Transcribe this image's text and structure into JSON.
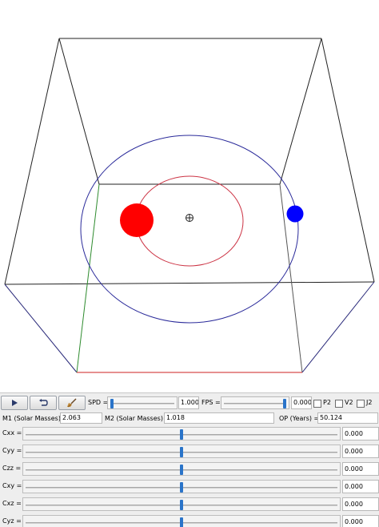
{
  "toolbar": {
    "spd_label": "SPD =",
    "spd_value": "1.000",
    "spd_level": 0.01,
    "fps_label": "FPS =",
    "fps_value": "0.000",
    "fps_level": 0.99,
    "check_p2": "P2",
    "check_v2": "V2",
    "check_j2": "J2",
    "buttons": [
      "play-icon",
      "reset-icon",
      "broom-icon"
    ]
  },
  "masses": {
    "m1_label": "M1 (Solar Masses) =",
    "m1_value": "2.063",
    "m2_label": "M2 (Solar Masses) =",
    "m2_value": "1.018",
    "op_label": "OP (Years) =",
    "op_value": "50.124"
  },
  "tensor": [
    {
      "label": "Cxx =",
      "value": "0.000",
      "level": 0.5
    },
    {
      "label": "Cyy =",
      "value": "0.000",
      "level": 0.5
    },
    {
      "label": "Czz =",
      "value": "0.000",
      "level": 0.5
    },
    {
      "label": "Cxy =",
      "value": "0.000",
      "level": 0.5
    },
    {
      "label": "Cxz =",
      "value": "0.000",
      "level": 0.5
    },
    {
      "label": "Cyz =",
      "value": "0.000",
      "level": 0.5
    }
  ],
  "colors": {
    "box_edge": "#222222",
    "axis_green": "#2e8b2e",
    "axis_red": "#cc2222",
    "axis_blue": "#2a2a9a",
    "star1": "#ff0000",
    "star2": "#0000ff",
    "orbit1": "#cc3344",
    "orbit2": "#2a2a9a",
    "slider_thumb": "#2a74c9"
  }
}
